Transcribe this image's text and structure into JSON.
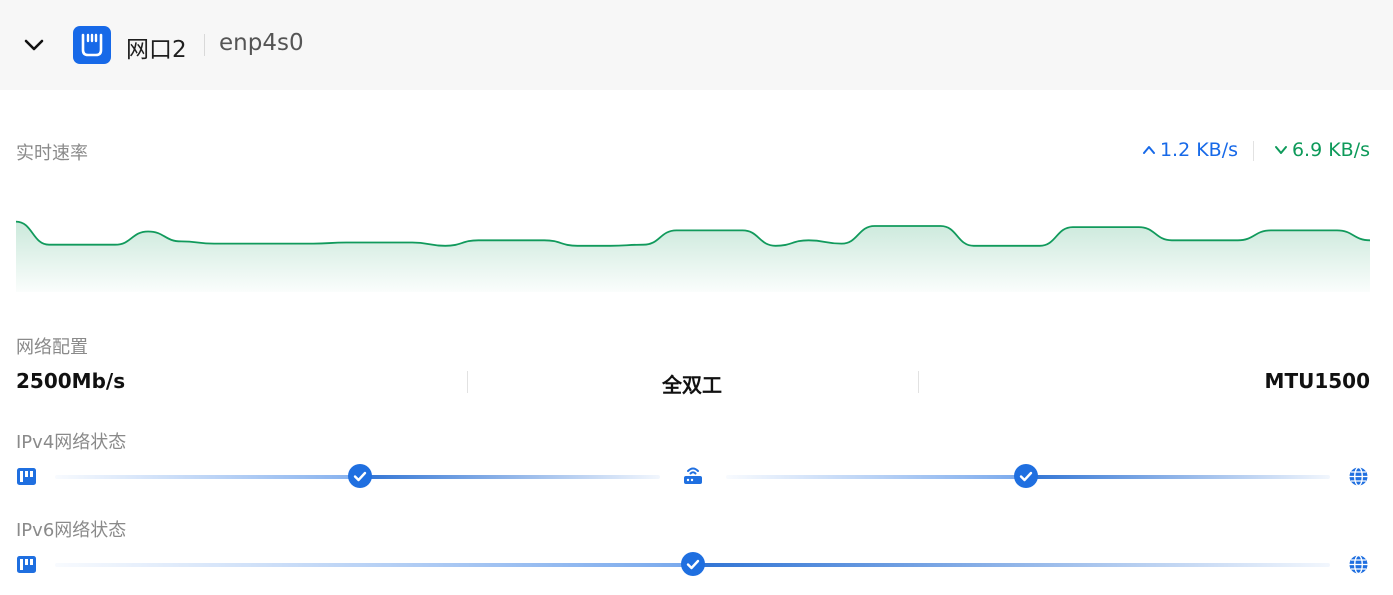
{
  "header": {
    "interface_name": "网口2",
    "device_name": "enp4s0",
    "expand_icon": "chevron-down-icon",
    "port_icon": "ethernet-port-icon"
  },
  "realtime": {
    "label": "实时速率",
    "upload": "1.2 KB/s",
    "download": "6.9 KB/s",
    "upload_color": "#1769e8",
    "download_color": "#0e9a5a"
  },
  "chart_data": {
    "type": "area",
    "title": "",
    "xlabel": "",
    "ylabel": "",
    "grid": false,
    "legend": "none",
    "series": [
      {
        "values": [
          6.4,
          4.3,
          4.3,
          4.3,
          5.5,
          4.6,
          4.4,
          4.4,
          4.4,
          4.4,
          4.5,
          4.5,
          4.5,
          4.2,
          4.7,
          4.7,
          4.7,
          4.2,
          4.2,
          4.3,
          5.6,
          5.6,
          5.6,
          4.2,
          4.7,
          4.4,
          6.0,
          6.0,
          6.0,
          4.2,
          4.2,
          4.2,
          5.9,
          5.9,
          5.9,
          4.7,
          4.7,
          4.7,
          5.6,
          5.6,
          5.6,
          4.7
        ],
        "color": "#119a5c"
      }
    ],
    "ylim": [
      0,
      8
    ]
  },
  "config": {
    "label": "网络配置",
    "speed": "2500Mb/s",
    "duplex": "全双工",
    "mtu": "MTU1500"
  },
  "ipv4": {
    "label": "IPv4网络状态",
    "left_icon": "ethernet-adapter-icon",
    "router_icon": "router-icon",
    "right_icon": "globe-icon",
    "check_icon": "check-icon"
  },
  "ipv6": {
    "label": "IPv6网络状态",
    "left_icon": "ethernet-adapter-icon",
    "right_icon": "globe-icon",
    "check_icon": "check-icon"
  }
}
